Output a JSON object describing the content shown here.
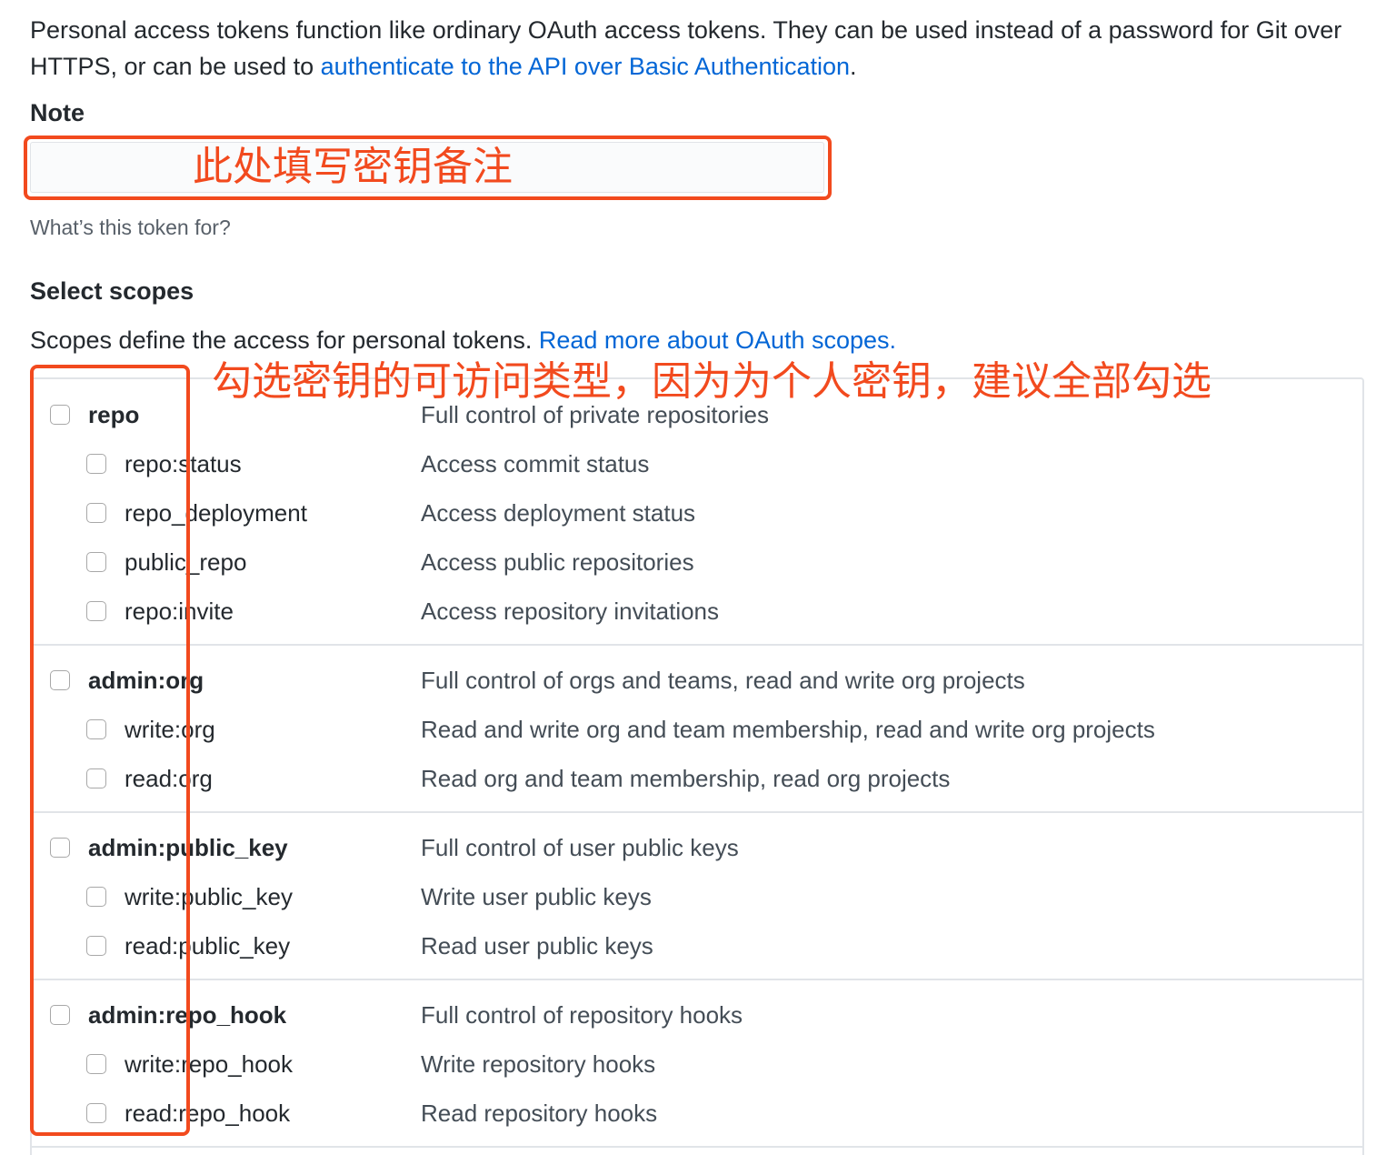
{
  "intro": {
    "text": "Personal access tokens function like ordinary OAuth access tokens. They can be used instead of a password for Git over HTTPS, or can be used to ",
    "link": "authenticate to the API over Basic Authentication",
    "suffix": "."
  },
  "note": {
    "label": "Note",
    "value": "",
    "hint": "What’s this token for?"
  },
  "scopes": {
    "title": "Select scopes",
    "description": "Scopes define the access for personal tokens. ",
    "link": "Read more about OAuth scopes.",
    "groups": [
      {
        "name": "repo",
        "desc": "Full control of private repositories",
        "children": [
          {
            "name": "repo:status",
            "desc": "Access commit status"
          },
          {
            "name": "repo_deployment",
            "desc": "Access deployment status"
          },
          {
            "name": "public_repo",
            "desc": "Access public repositories"
          },
          {
            "name": "repo:invite",
            "desc": "Access repository invitations"
          }
        ]
      },
      {
        "name": "admin:org",
        "desc": "Full control of orgs and teams, read and write org projects",
        "children": [
          {
            "name": "write:org",
            "desc": "Read and write org and team membership, read and write org projects"
          },
          {
            "name": "read:org",
            "desc": "Read org and team membership, read org projects"
          }
        ]
      },
      {
        "name": "admin:public_key",
        "desc": "Full control of user public keys",
        "children": [
          {
            "name": "write:public_key",
            "desc": "Write user public keys"
          },
          {
            "name": "read:public_key",
            "desc": "Read user public keys"
          }
        ]
      },
      {
        "name": "admin:repo_hook",
        "desc": "Full control of repository hooks",
        "children": [
          {
            "name": "write:repo_hook",
            "desc": "Write repository hooks"
          },
          {
            "name": "read:repo_hook",
            "desc": "Read repository hooks"
          }
        ]
      }
    ]
  },
  "annotations": {
    "note_callout": "此处填写密钥备注",
    "scopes_callout": "勾选密钥的可访问类型，因为为个人密钥，建议全部勾选",
    "color": "#f24a1e"
  },
  "colors": {
    "link": "#0366d6",
    "text": "#24292e",
    "muted": "#586069"
  }
}
